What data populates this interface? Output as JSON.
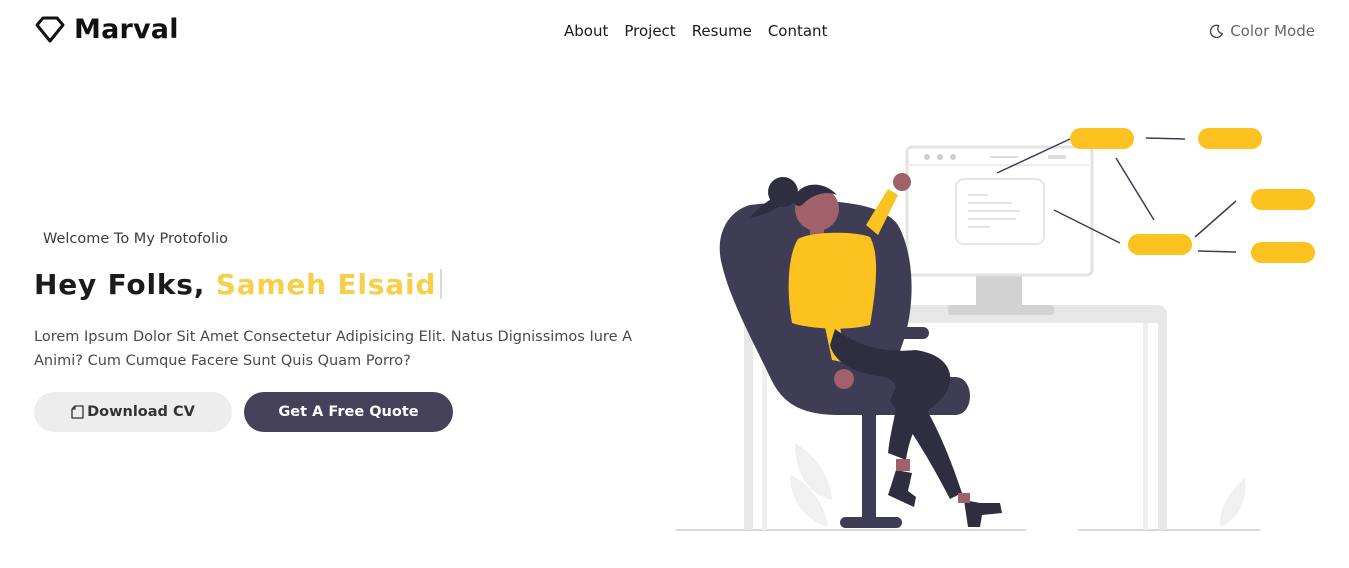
{
  "brand": {
    "name": "Marval",
    "logo_icon": "diamond-icon"
  },
  "nav": {
    "links": [
      {
        "label": "About"
      },
      {
        "label": "Project"
      },
      {
        "label": "Resume"
      },
      {
        "label": "Contant"
      }
    ],
    "color_mode": {
      "label": "Color Mode",
      "icon": "moon-icon"
    }
  },
  "hero": {
    "welcome": "Welcome To My Protofolio",
    "greeting": "Hey Folks,",
    "name": "Sameh Elsaid",
    "description": "Lorem Ipsum Dolor Sit Amet Consectetur Adipisicing Elit. Natus Dignissimos Iure A Animi? Cum Cumque Facere Sunt Quis Quam Porro?",
    "buttons": {
      "download_cv": "Download CV",
      "download_icon": "file-icon",
      "quote": "Get A Free Quote"
    }
  },
  "illustration": {
    "subject": "woman-at-desk-illustration"
  },
  "colors": {
    "accent_yellow": "#fbc220",
    "name_yellow": "#f7cf4a",
    "primary_dark": "#45415a",
    "button_light": "#ededed"
  }
}
